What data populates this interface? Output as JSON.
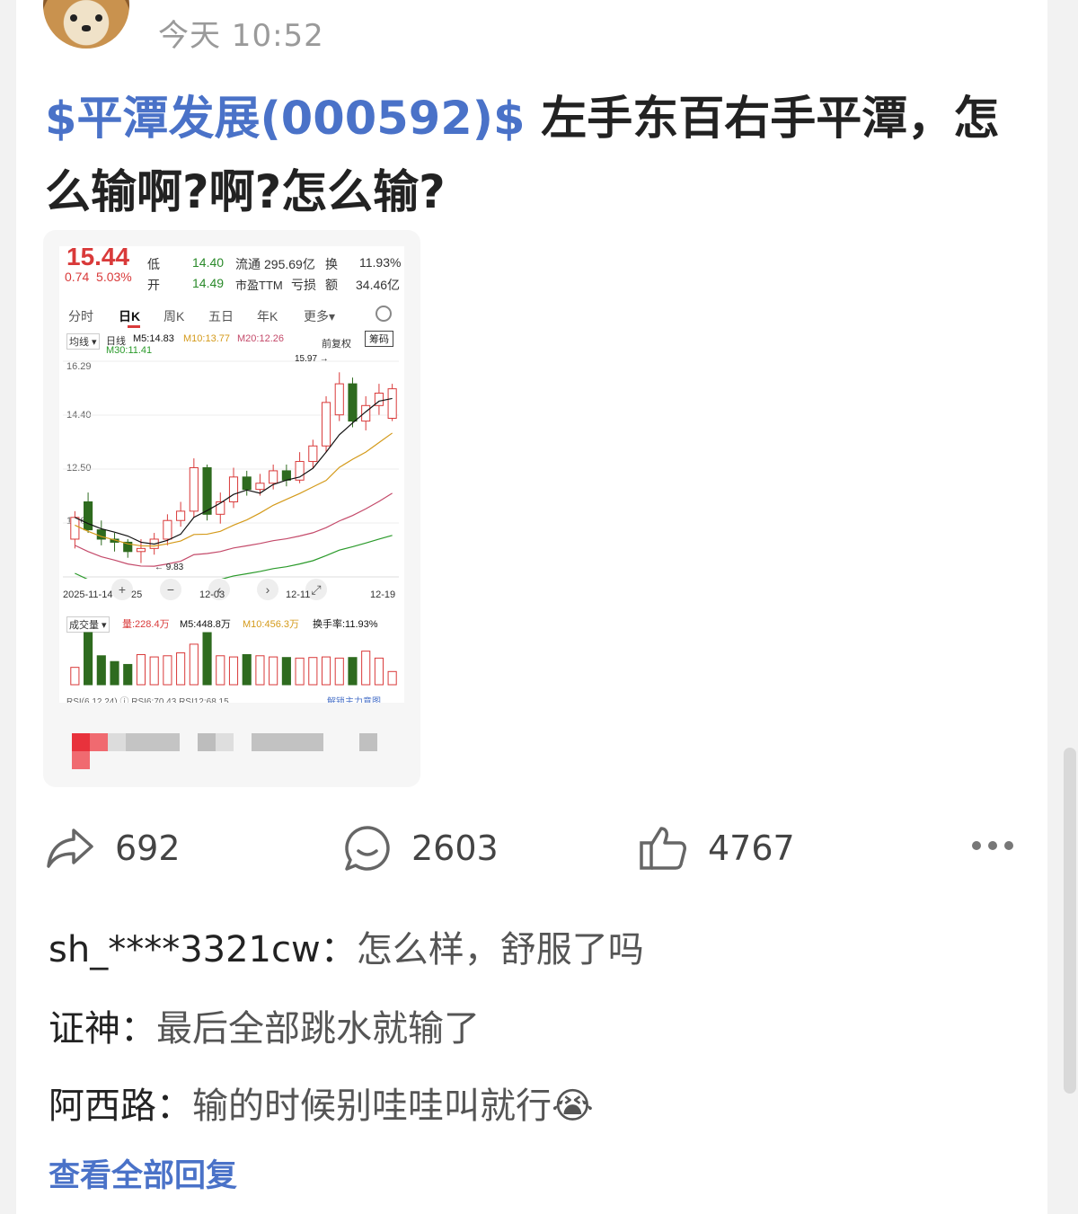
{
  "header": {
    "time": "今天 10:52"
  },
  "post": {
    "stock_link": "$平潭发展(000592)$",
    "body": " 左手东百右手平潭，怎么输啊?啊?怎么输?"
  },
  "quote": {
    "price": "15.44",
    "change": "0.74",
    "change_pct": "5.03%",
    "low_label": "低",
    "low_value": "14.40",
    "open_label": "开",
    "open_value": "14.49",
    "float_label": "流通",
    "float_value": "295.69亿",
    "pe_label": "市盈TTM",
    "pe_value": "亏损",
    "turnover_label": "换",
    "turnover_value": "11.93%",
    "amount_label": "额",
    "amount_value": "34.46亿"
  },
  "kline": {
    "tabs": [
      "分时",
      "日K",
      "周K",
      "五日",
      "年K",
      "更多▾"
    ],
    "active_tab": "日K",
    "ma_type": "均线 ▾",
    "ma_label": "日线",
    "ma5": "M5:14.83",
    "ma10": "M10:13.77",
    "ma20": "M20:12.26",
    "ma30": "M30:11.41",
    "adjust": "前复权",
    "chip_btn": "筹码",
    "high_mark": "15.97",
    "low_mark": "9.83",
    "y_ticks": [
      "16.29",
      "14.40",
      "12.50",
      "10.60"
    ],
    "dates": [
      "2025-11-14",
      "25",
      "12-03",
      "12-11",
      "12-19"
    ],
    "vol_label": "成交量 ▾",
    "vol_value": "量:228.4万",
    "vol_m5": "M5:448.8万",
    "vol_m10": "M10:456.3万",
    "turnover_rate": "换手率:11.93%",
    "rsi_row": "RSI(6,12,24) ⓘ  RSI6:70.43  RSI12:68.15",
    "rsi_link": "解锁主力意图",
    "chart_data": {
      "type": "candlestick",
      "categories": [
        "2025-11-14",
        "",
        "",
        "",
        "",
        "",
        "",
        "25",
        "",
        "",
        "",
        "",
        "12-03",
        "",
        "",
        "",
        "",
        "",
        "12-11",
        "",
        "",
        "",
        "",
        "",
        "12-19"
      ],
      "series": [
        {
          "name": "日K",
          "values": [
            [
              10.6,
              11.3,
              10.3,
              11.5
            ],
            [
              11.8,
              10.9,
              10.8,
              12.1
            ],
            [
              10.9,
              10.6,
              10.4,
              11.2
            ],
            [
              10.6,
              10.5,
              10.2,
              10.8
            ],
            [
              10.5,
              10.2,
              10.0,
              10.6
            ],
            [
              10.2,
              10.3,
              9.83,
              10.6
            ],
            [
              10.3,
              10.6,
              10.1,
              10.8
            ],
            [
              10.6,
              11.2,
              10.4,
              11.4
            ],
            [
              11.2,
              11.5,
              11.0,
              11.8
            ],
            [
              11.5,
              12.9,
              11.3,
              13.2
            ],
            [
              12.9,
              11.4,
              11.2,
              13.0
            ],
            [
              11.4,
              11.8,
              11.1,
              12.1
            ],
            [
              11.8,
              12.6,
              11.6,
              12.9
            ],
            [
              12.6,
              12.2,
              12.0,
              12.8
            ],
            [
              12.2,
              12.4,
              12.0,
              12.7
            ],
            [
              12.4,
              12.8,
              12.2,
              13.0
            ],
            [
              12.8,
              12.5,
              12.3,
              13.0
            ],
            [
              12.5,
              13.1,
              12.4,
              13.4
            ],
            [
              13.1,
              13.6,
              12.9,
              13.8
            ],
            [
              13.6,
              15.0,
              13.4,
              15.2
            ],
            [
              14.6,
              15.6,
              14.4,
              15.97
            ],
            [
              15.6,
              14.4,
              14.2,
              15.8
            ],
            [
              14.4,
              14.9,
              14.1,
              15.2
            ],
            [
              14.9,
              15.3,
              14.6,
              15.6
            ],
            [
              14.49,
              15.44,
              14.4,
              15.6
            ]
          ]
        }
      ],
      "ylim": [
        9.5,
        16.5
      ]
    },
    "volume_data": {
      "type": "bar",
      "values": [
        300,
        900,
        500,
        400,
        350,
        520,
        480,
        500,
        550,
        700,
        900,
        500,
        480,
        520,
        500,
        480,
        470,
        460,
        470,
        480,
        460,
        470,
        580,
        460,
        228
      ]
    }
  },
  "actions": {
    "share_count": "692",
    "comment_count": "2603",
    "like_count": "4767"
  },
  "comments": [
    {
      "name": "sh_****3321cw：",
      "text": "怎么样，舒服了吗"
    },
    {
      "name": "证神：",
      "text": "最后全部跳水就输了"
    },
    {
      "name": "阿西路：",
      "text": "输的时候别哇哇叫就行😭"
    }
  ],
  "view_all": "查看全部回复",
  "colors": {
    "link": "#4a72c8",
    "up": "#d93a3a",
    "down": "#2e6b1f"
  }
}
